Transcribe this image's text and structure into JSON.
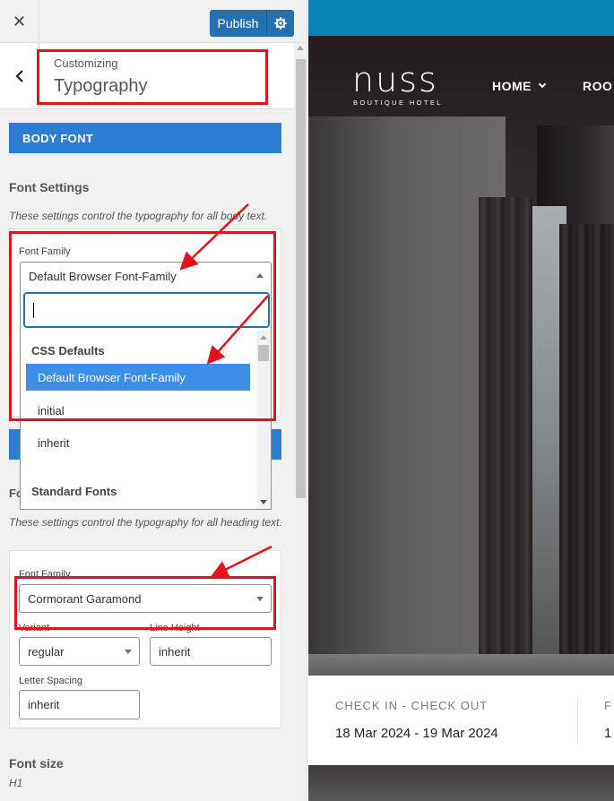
{
  "topbar": {
    "close_symbol": "✕",
    "publish_label": "Publish"
  },
  "section": {
    "breadcrumb": "Customizing",
    "title": "Typography"
  },
  "body_font": {
    "band_label": "BODY FONT",
    "group_title": "Font Settings",
    "group_desc": "These settings control the typography for all body text.",
    "font_family_label": "Font Family",
    "font_family_value": "Default Browser Font-Family",
    "dropdown": {
      "search_value": "",
      "groups": [
        {
          "label": "CSS Defaults",
          "options": [
            "Default Browser Font-Family",
            "initial",
            "inherit"
          ]
        },
        {
          "label": "Standard Fonts",
          "options": []
        }
      ],
      "selected_option": "Default Browser Font-Family"
    }
  },
  "heading_font": {
    "group_title_partial": "Fo",
    "group_desc": "These settings control the typography for all heading text.",
    "font_family_label": "Font Family",
    "font_family_value": "Cormorant Garamond",
    "variant_label": "Variant",
    "variant_value": "regular",
    "line_height_label": "Line Height",
    "line_height_value": "inherit",
    "letter_spacing_label": "Letter Spacing",
    "letter_spacing_value": "inherit"
  },
  "font_size": {
    "title": "Font size",
    "sub": "H1"
  },
  "preview": {
    "logo": "nuss",
    "tagline": "BOUTIQUE HOTEL",
    "nav": {
      "home": "HOME",
      "rooms": "ROO"
    },
    "booking": {
      "label": "CHECK IN - CHECK OUT",
      "value": "18 Mar 2024 - 19 Mar 2024",
      "next_label": "F",
      "next_value": "1"
    }
  },
  "colors": {
    "accent_blue": "#2d7dd2",
    "annotation_red": "#e3121c",
    "wp_blue": "#2271b1"
  }
}
